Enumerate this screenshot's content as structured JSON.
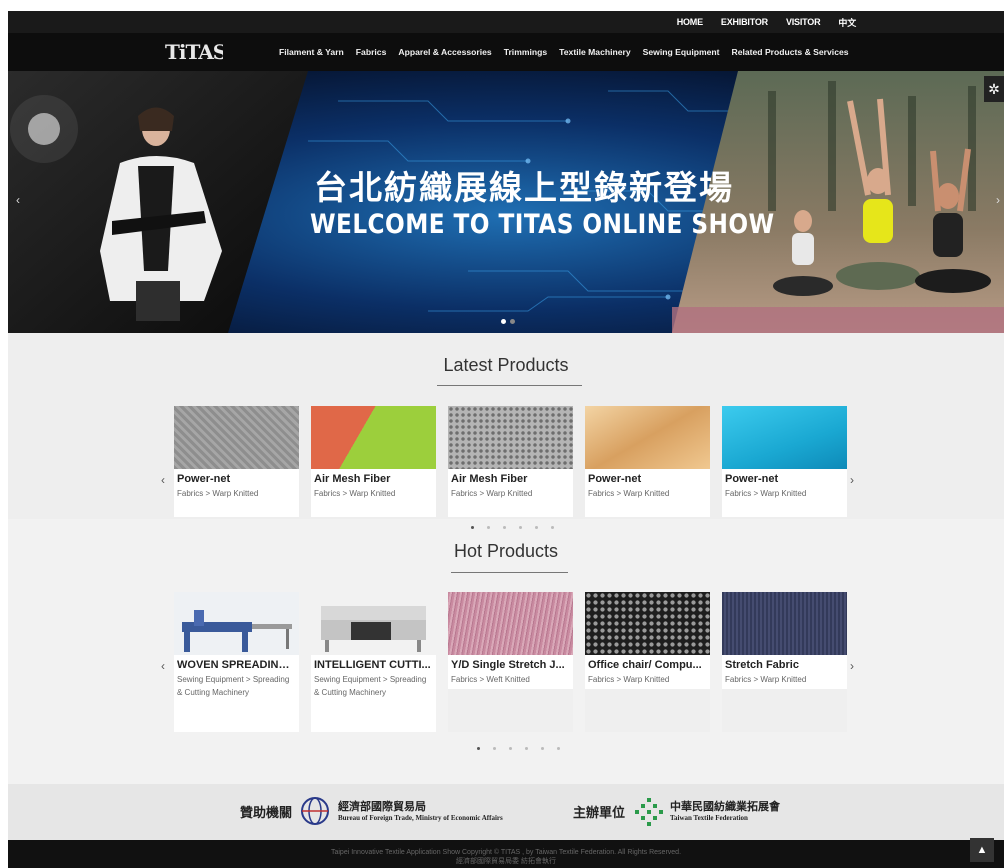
{
  "topbar": {
    "items": [
      "HOME",
      "EXHIBITOR",
      "VISITOR",
      "中文"
    ]
  },
  "brand": {
    "logo_text": "TITAS"
  },
  "nav": {
    "items": [
      "Filament & Yarn",
      "Fabrics",
      "Apparel & Accessories",
      "Trimmings",
      "Textile Machinery",
      "Sewing Equipment",
      "Related Products & Services"
    ]
  },
  "hero": {
    "title_cn": "台北紡織展線上型錄新登場",
    "title_en": "WELCOME TO TITAS ONLINE SHOW",
    "prev": "‹",
    "next": "›"
  },
  "latest": {
    "title": "Latest Products",
    "items": [
      {
        "name": "Power-net",
        "category": "Fabrics > Warp Knitted",
        "color": "#9a9a9a"
      },
      {
        "name": "Air Mesh Fiber",
        "category": "Fabrics > Warp Knitted",
        "color": "#8fc43a"
      },
      {
        "name": "Air Mesh Fiber",
        "category": "Fabrics > Warp Knitted",
        "color": "#a8a8a8"
      },
      {
        "name": "Power-net",
        "category": "Fabrics > Warp Knitted",
        "color": "#e8b878"
      },
      {
        "name": "Power-net",
        "category": "Fabrics > Warp Knitted",
        "color": "#1ab3d8"
      }
    ]
  },
  "hot": {
    "title": "Hot Products",
    "items": [
      {
        "name": "WOVEN SPREADING...",
        "category": "Sewing Equipment > Spreading & Cutting Machinery",
        "color": "#dfe4ea"
      },
      {
        "name": "INTELLIGENT CUTTI...",
        "category": "Sewing Equipment > Spreading & Cutting Machinery",
        "color": "#e2e2e2"
      },
      {
        "name": "Y/D Single Stretch J...",
        "category": "Fabrics > Weft Knitted",
        "color": "#c98aa0"
      },
      {
        "name": "Office chair/ Compu...",
        "category": "Fabrics > Warp Knitted",
        "color": "#2a2a2a"
      },
      {
        "name": "Stretch Fabric",
        "category": "Fabrics > Warp Knitted",
        "color": "#3b4060"
      }
    ]
  },
  "sponsor": {
    "label1": "贊助機關",
    "org1_cn": "經濟部國際貿易局",
    "org1_en": "Bureau of Foreign Trade, Ministry of Economic Affairs",
    "label2": "主辦單位",
    "org2_cn": "中華民國紡織業拓展會",
    "org2_en": "Taiwan Textile Federation"
  },
  "footer": {
    "copyright": "Taipei Innovative Textile Application Show Copyright © TITAS , by Taiwan Textile Federation. All Rights Reserved.",
    "subline": "經濟部國際貿易局委 紡拓會執行",
    "to_top": "▲"
  }
}
